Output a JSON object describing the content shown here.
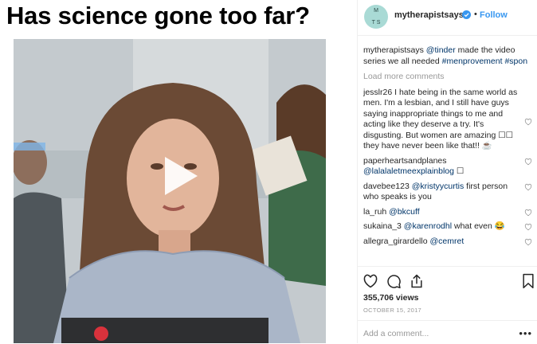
{
  "headline": "Has science gone too far?",
  "post": {
    "avatar_lines": [
      "M",
      "T S"
    ],
    "username": "mytherapistsays",
    "dot": "•",
    "follow_label": "Follow",
    "caption": {
      "user": "mytherapistsays",
      "mention": "@tinder",
      "text": " made the video series we all needed ",
      "tag1": "#menprovement",
      "tag2": "#spon"
    },
    "load_more": "Load more comments",
    "comments": [
      {
        "user": "jesslr26",
        "text": "I hate being in the same world as men. I'm a lesbian, and I still have guys saying inappropriate things to me and acting like they deserve a try. It's disgusting. But women are amazing ☐☐ they have never been like that!! ☕",
        "mention": ""
      },
      {
        "user": "paperheartsandplanes",
        "mention": "@lalalaletmeexplainblog",
        "text": " ☐"
      },
      {
        "user": "davebee123",
        "mention": "@kristyycurtis",
        "text": " first person who speaks is you"
      },
      {
        "user": "la_ruh",
        "mention": "@bkcuff",
        "text": ""
      },
      {
        "user": "sukaina_3",
        "mention": "@karenrodhl",
        "text": " what even 😂"
      },
      {
        "user": "allegra_girardello",
        "mention": "@cemret",
        "text": ""
      }
    ],
    "views": "355,706 views",
    "date": "OCTOBER 15, 2017",
    "add_comment_placeholder": "Add a comment...",
    "more": "•••"
  },
  "icons": {
    "play": "play-icon",
    "like": "heart-icon",
    "comment": "comment-icon",
    "share": "share-icon",
    "save": "bookmark-icon",
    "verified": "verified-badge-icon"
  },
  "colors": {
    "link": "#3897f0",
    "mention": "#003569",
    "muted": "#999999",
    "avatar_bg": "#a9dad5"
  }
}
